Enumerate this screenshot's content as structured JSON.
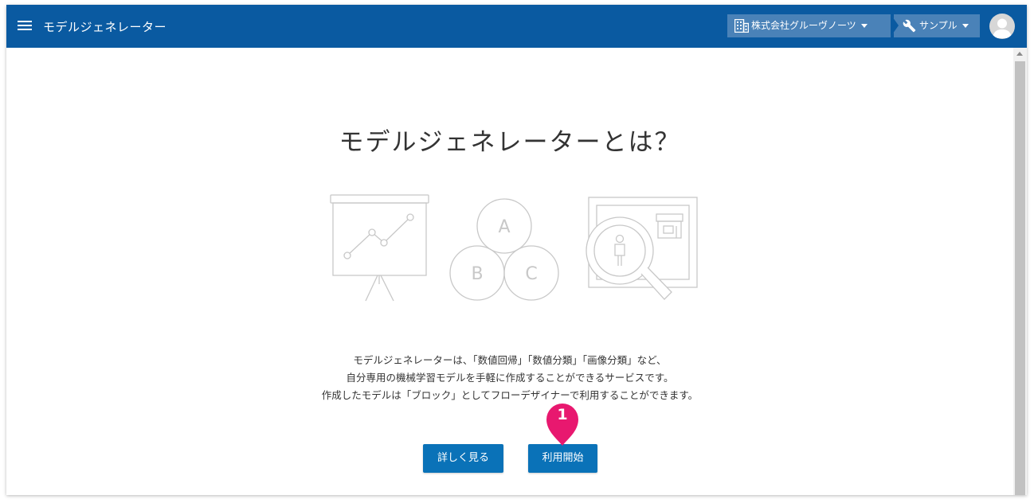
{
  "header": {
    "app_title": "モデルジェネレーター",
    "organization": "株式会社グルーヴノーツ",
    "project": "サンプル",
    "icons": {
      "menu": "hamburger-menu-icon",
      "organization": "building-icon",
      "project": "wrench-icon",
      "avatar": "user-avatar-icon"
    }
  },
  "main": {
    "title": "モデルジェネレーターとは？",
    "illustration_letters": [
      "A",
      "B",
      "C"
    ],
    "description": [
      "モデルジェネレーターは、「数値回帰」「数値分類」「画像分類」など、",
      "自分専用の機械学習モデルを手軽に作成することができるサービスです。",
      "作成したモデルは「ブロック」としてフローデザイナーで利用することができます。"
    ],
    "details_button": "詳しく見る",
    "start_button": "利用開始",
    "step_marker": "1"
  },
  "colors": {
    "header_bg": "#0a5aa1",
    "breadcrumb_bg": "#4a82b8",
    "button_bg": "#0a72b8",
    "marker": "#e8186f",
    "illustration_stroke": "#c8c8c8"
  }
}
